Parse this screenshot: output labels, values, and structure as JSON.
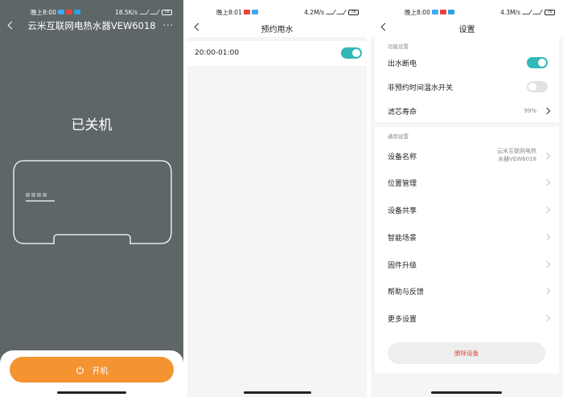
{
  "panel1": {
    "status": {
      "time": "晚上8:00",
      "speed": "18.5K/s",
      "battery": "76"
    },
    "title": "云米互联网电热水器VEW6018",
    "more": "···",
    "state_text": "已关机",
    "power_label": "开机",
    "colors": {
      "background": "#5e6667",
      "power_button": "#f39431"
    }
  },
  "panel2": {
    "status": {
      "time": "晚上8:01",
      "speed": "4.2M/s",
      "battery": "76"
    },
    "title": "预约用水",
    "schedule": {
      "time_range": "20:00-01:00",
      "enabled": true
    }
  },
  "panel3": {
    "status": {
      "time": "晚上8:00",
      "speed": "4.3M/s",
      "battery": "76"
    },
    "title": "设置",
    "section_function": "功能设置",
    "power_cut": {
      "label": "出水断电",
      "enabled": true
    },
    "non_schedule_keep_warm": {
      "label": "非预约时间温水开关",
      "enabled": false
    },
    "filter_life": {
      "label": "滤芯寿命",
      "value": "99%"
    },
    "section_general": "通用设置",
    "device_name": {
      "label": "设备名称",
      "value_line1": "云米互联网电热",
      "value_line2": "水器VEW6018"
    },
    "items": {
      "location": "位置管理",
      "share": "设备共享",
      "scene": "智能场景",
      "firmware": "固件升级",
      "help": "帮助与反馈",
      "more": "更多设置"
    },
    "delete_label": "删除设备",
    "colors": {
      "toggle_on": "#33b8b8",
      "delete_text": "#e34a3c"
    }
  }
}
